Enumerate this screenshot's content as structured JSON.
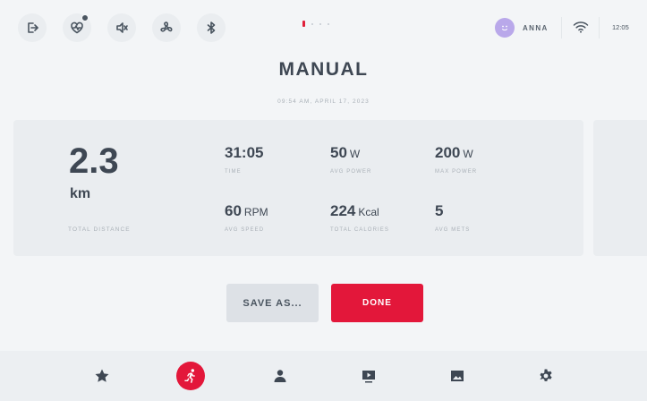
{
  "topbar": {
    "icons": [
      "exit-icon",
      "heart-rate-icon",
      "volume-icon",
      "fan-icon",
      "bluetooth-icon"
    ],
    "pager": {
      "count": 4,
      "active": 0
    },
    "user": {
      "name": "ANNA"
    },
    "time": "12:05"
  },
  "workout": {
    "title": "MANUAL",
    "datetime": "09:54 AM, APRIL 17, 2023"
  },
  "stats": {
    "distance": {
      "value": "2.3",
      "unit": "km",
      "label": "TOTAL DISTANCE"
    },
    "time": {
      "value": "31:05",
      "label": "TIME"
    },
    "avg_power": {
      "value": "50",
      "unit": "W",
      "label": "AVG POWER"
    },
    "max_power": {
      "value": "200",
      "unit": "W",
      "label": "MAX POWER"
    },
    "avg_speed": {
      "value": "60",
      "unit": "RPM",
      "label": "AVG SPEED"
    },
    "calories": {
      "value": "224",
      "unit": "Kcal",
      "label": "TOTAL CALORIES"
    },
    "mets": {
      "value": "5",
      "label": "AVG METS"
    }
  },
  "actions": {
    "save_as": "SAVE AS...",
    "done": "DONE"
  },
  "colors": {
    "accent": "#e3173a",
    "avatar": "#b9a8ea"
  },
  "bottom_nav": {
    "items": [
      "star-icon",
      "running-icon",
      "user-icon",
      "video-icon",
      "image-icon",
      "gear-icon"
    ],
    "active": "running-icon"
  }
}
